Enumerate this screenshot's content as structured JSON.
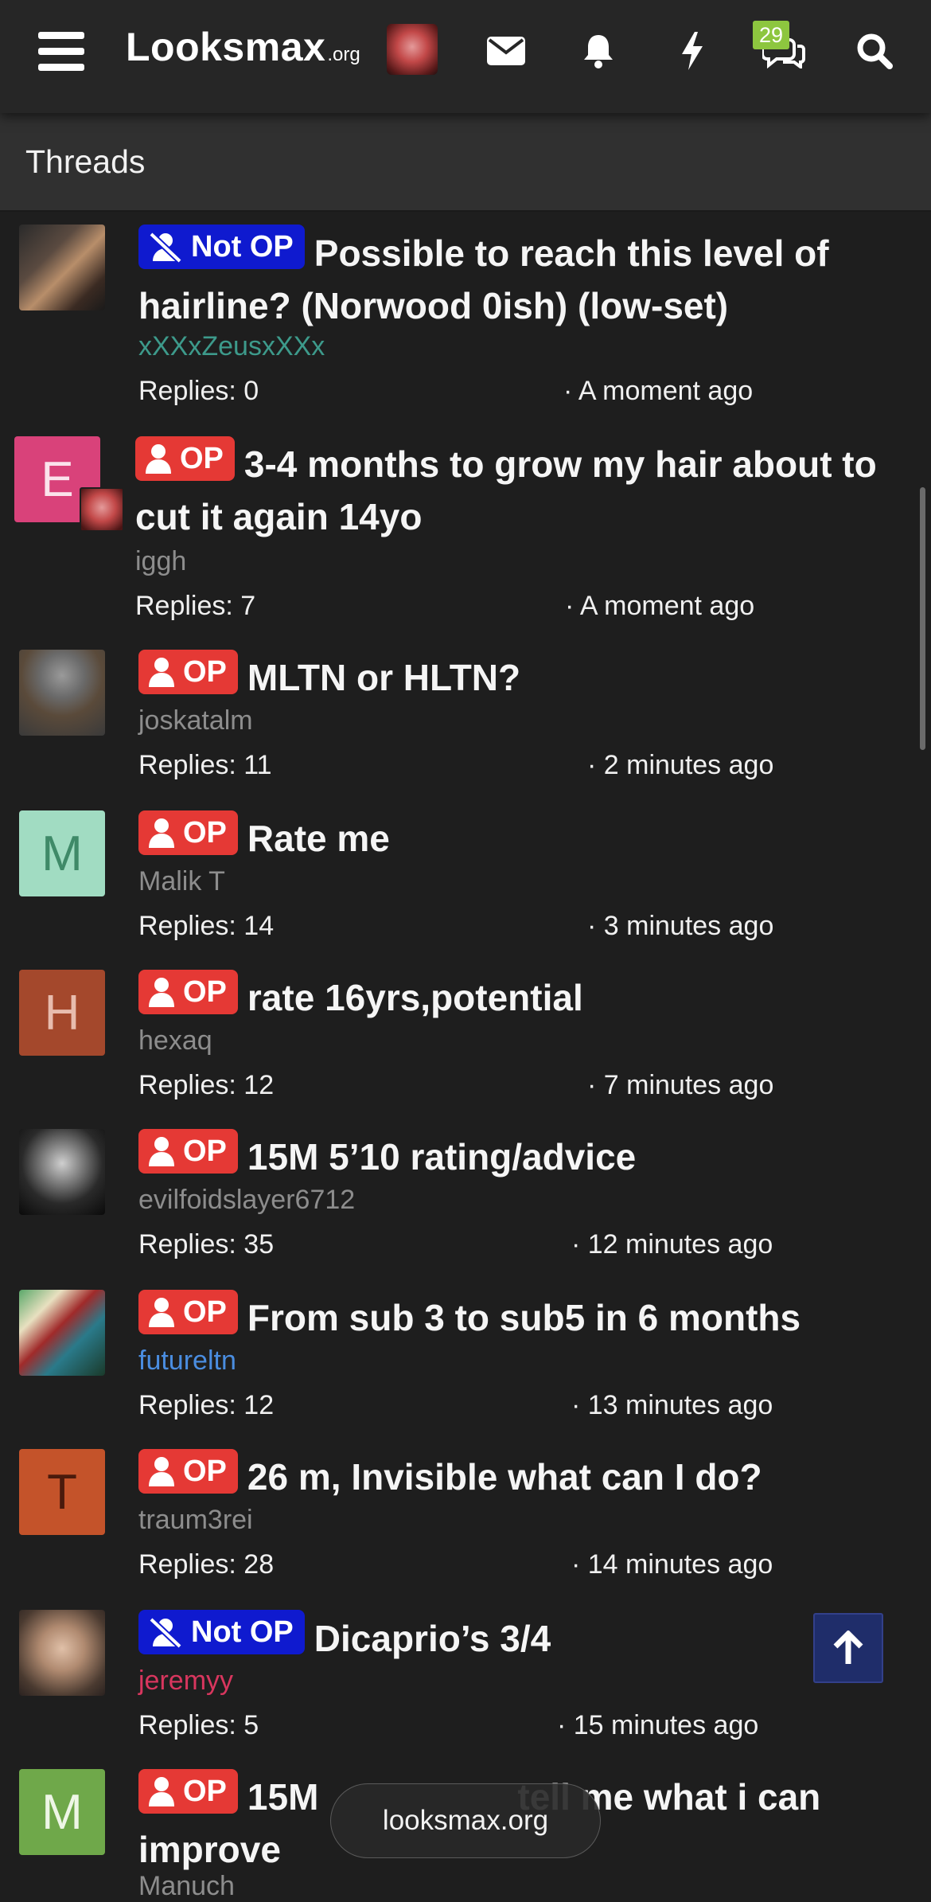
{
  "header": {
    "logo_main": "Looksmax",
    "logo_org": ".org",
    "alerts_count": "29"
  },
  "section": {
    "title": "Threads"
  },
  "threads": [
    {
      "label": "Not OP",
      "label_type": "notop",
      "title": "Possible to reach this level of hairline? (Norwood 0ish) (low-set)",
      "author": "xXXxZeusxXXx",
      "author_color": "#3d9a8b",
      "replies": "Replies: 0",
      "time": "· A moment ago"
    },
    {
      "label": "OP",
      "label_type": "op",
      "title": "3-4 months to grow my hair about to cut it again 14yo",
      "author": "iggh",
      "author_color": "#8d8d8d",
      "avatar_letter": "E",
      "avatar_color": "#d9427a",
      "replies": "Replies: 7",
      "time": "· A moment ago"
    },
    {
      "label": "OP",
      "label_type": "op",
      "title": "MLTN or HLTN?",
      "author": "joskatalm",
      "author_color": "#8d8d8d",
      "replies": "Replies: 11",
      "time": "· 2 minutes ago"
    },
    {
      "label": "OP",
      "label_type": "op",
      "title": "Rate me",
      "author": "Malik T",
      "author_color": "#8d8d8d",
      "avatar_letter": "M",
      "avatar_color": "#a1dcc2",
      "avatar_text_color": "#3f8a68",
      "replies": "Replies: 14",
      "time": "· 3 minutes ago"
    },
    {
      "label": "OP",
      "label_type": "op",
      "title": "rate 16yrs,potential",
      "author": "hexaq",
      "author_color": "#8d8d8d",
      "avatar_letter": "H",
      "avatar_color": "#a4482c",
      "avatar_text_color": "#e8bcae",
      "replies": "Replies: 12",
      "time": "· 7 minutes ago"
    },
    {
      "label": "OP",
      "label_type": "op",
      "title": "15M 5’10 rating/advice",
      "author": "evilfoidslayer6712",
      "author_color": "#8d8d8d",
      "replies": "Replies: 35",
      "time": "· 12 minutes ago"
    },
    {
      "label": "OP",
      "label_type": "op",
      "title": "From sub 3 to sub5 in 6 months",
      "author": "futureltn",
      "author_color": "#4a8de0",
      "replies": "Replies: 12",
      "time": "· 13 minutes ago"
    },
    {
      "label": "OP",
      "label_type": "op",
      "title": "26 m, Invisible what can I do?",
      "author": "traum3rei",
      "author_color": "#8d8d8d",
      "avatar_letter": "T",
      "avatar_color": "#c4532a",
      "avatar_text_color": "#4a1a0c",
      "replies": "Replies: 28",
      "time": "· 14 minutes ago"
    },
    {
      "label": "Not OP",
      "label_type": "notop",
      "title": "Dicaprio’s 3/4",
      "author": "jeremyy",
      "author_color": "#d8365e",
      "replies": "Replies: 5",
      "time": "· 15 minutes ago"
    },
    {
      "label": "OP",
      "label_type": "op",
      "title_visible_start": "15M",
      "title_visible_end": "tell me what i can",
      "title_visible_line2": "improve",
      "author": "Manuch",
      "author_color": "#8d8d8d",
      "avatar_letter": "M",
      "avatar_color": "#6fa84a",
      "avatar_text_color": "#eef6e6"
    }
  ],
  "url_pill": "looksmax.org",
  "icons": {
    "menu": "hamburger-menu-icon",
    "mail": "envelope-icon",
    "bell": "bell-icon",
    "lightning": "lightning-icon",
    "chat": "chat-bubbles-icon",
    "search": "search-icon",
    "user_label": "user-icon",
    "user_slash_label": "user-slash-icon",
    "back_to_top": "arrow-up-icon"
  },
  "colors": {
    "op_label": "#e53935",
    "notop_label": "#0f1acf",
    "alert_badge": "#8dc63f",
    "back_to_top": "#1f2d6a"
  }
}
